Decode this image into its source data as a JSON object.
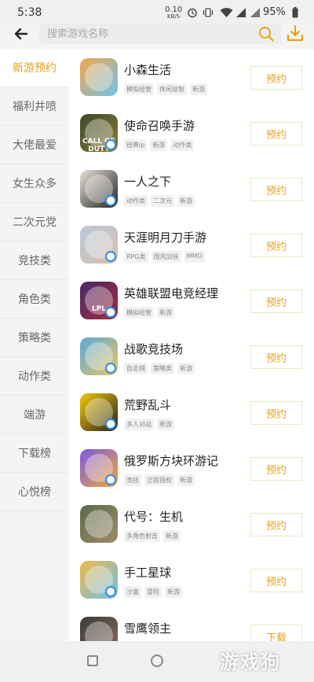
{
  "status_bar": {
    "time": "5:38",
    "net_speed": "0.10",
    "net_unit": "KB/S",
    "battery": "95%"
  },
  "search": {
    "placeholder": "搜索游戏名称"
  },
  "sidebar": {
    "items": [
      {
        "label": "新游预约",
        "active": true
      },
      {
        "label": "福利井喷"
      },
      {
        "label": "大佬最爱"
      },
      {
        "label": "女生众多"
      },
      {
        "label": "二次元党"
      },
      {
        "label": "竞技类"
      },
      {
        "label": "角色类"
      },
      {
        "label": "策略类"
      },
      {
        "label": "动作类"
      },
      {
        "label": "端游"
      },
      {
        "label": "下载榜"
      },
      {
        "label": "心悦榜"
      }
    ]
  },
  "games": [
    {
      "name": "小森生活",
      "tags": [
        "模拟经营",
        "休闲益智",
        "新游"
      ],
      "action": "预约",
      "icon_color": "#f4a64a",
      "icon_color2": "#6fc3e8",
      "badge": false
    },
    {
      "name": "使命召唤手游",
      "tags": [
        "经典ip",
        "新游",
        "动作类"
      ],
      "action": "预约",
      "icon_color": "#3c4a2a",
      "icon_color2": "#8a7a3a",
      "icon_text": "CALL OF DUTY",
      "badge": true
    },
    {
      "name": "一人之下",
      "tags": [
        "动作类",
        "二次元",
        "新游"
      ],
      "action": "预约",
      "icon_color": "#e8e2d8",
      "icon_color2": "#222222",
      "badge": true
    },
    {
      "name": "天涯明月刀手游",
      "tags": [
        "RPG类",
        "国风剑侠",
        "MMO"
      ],
      "action": "预约",
      "icon_color": "#b8c8d8",
      "icon_color2": "#d8c0b0",
      "badge": true
    },
    {
      "name": "英雄联盟电竞经理",
      "tags": [
        "模拟经营",
        "新游"
      ],
      "action": "预约",
      "icon_color": "#4a2a6a",
      "icon_color2": "#a02a3a",
      "icon_text": "LPL",
      "badge": true
    },
    {
      "name": "战歌竞技场",
      "tags": [
        "自走棋",
        "策略类",
        "新游"
      ],
      "action": "预约",
      "icon_color": "#5aa8d8",
      "icon_color2": "#e8c860",
      "badge": true
    },
    {
      "name": "荒野乱斗",
      "tags": [
        "多人对战",
        "新游"
      ],
      "action": "预约",
      "icon_color": "#f4c800",
      "icon_color2": "#222222",
      "badge": true
    },
    {
      "name": "俄罗斯方块环游记",
      "tags": [
        "竞技",
        "正版授权",
        "新游"
      ],
      "action": "预约",
      "icon_color": "#7a5ae8",
      "icon_color2": "#f4a830",
      "badge": true
    },
    {
      "name": "代号：生机",
      "tags": [
        "多角色射击",
        "新游"
      ],
      "action": "预约",
      "icon_color": "#5a6a4a",
      "icon_color2": "#a08a6a",
      "badge": false
    },
    {
      "name": "手工星球",
      "tags": [
        "沙盒",
        "冒险",
        "新游"
      ],
      "action": "预约",
      "icon_color": "#f0b84a",
      "icon_color2": "#6ac0e8",
      "badge": true
    },
    {
      "name": "雪鹰领主",
      "tags": [],
      "action": "下载",
      "icon_color": "#3a3a3a",
      "icon_color2": "#8a6a5a",
      "badge": false
    }
  ],
  "colors": {
    "accent": "#e8a21a"
  },
  "watermark": "游戏狗"
}
